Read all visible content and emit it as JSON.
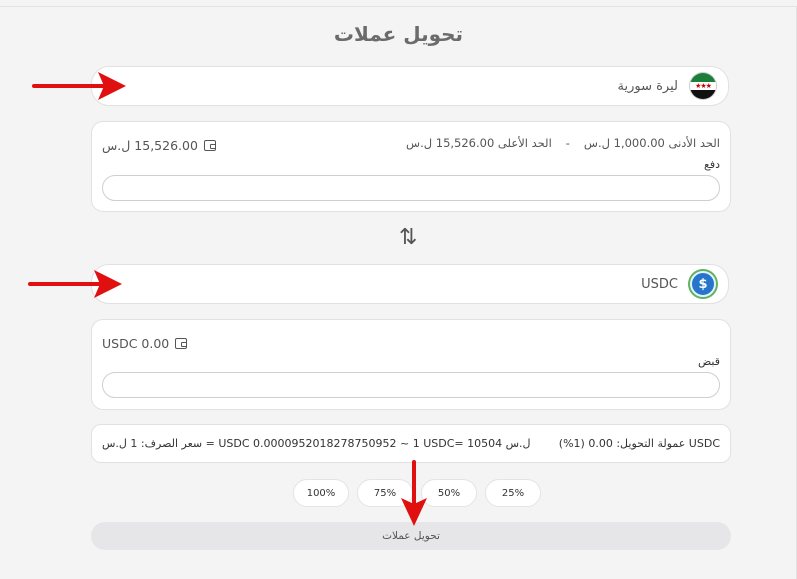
{
  "page": {
    "title": "تحويل عملات"
  },
  "from": {
    "currency_name": "ليرة سورية",
    "limits_min": "الحد الأدنى 1,000.00 ل.س",
    "limits_sep": "-",
    "limits_max": "الحد الأعلى 15,526.00 ل.س",
    "balance": "15,526.00 ل.س",
    "field_label": "دفع",
    "input_value": ""
  },
  "swap": {
    "symbol": "⇅"
  },
  "to": {
    "currency_name": "USDC",
    "balance": "USDC 0.00",
    "field_label": "قبض",
    "input_value": ""
  },
  "info": {
    "fee": "عمولة التحويل: 0.00 (1%) USDC",
    "rate": "سعر الصرف: 1 ل.س = USDC 0.0000952018278750952 ~ 1 USDC= 10504 ل.س"
  },
  "percent_buttons": [
    "100%",
    "75%",
    "50%",
    "25%"
  ],
  "submit": {
    "label": "تحويل عملات"
  },
  "colors": {
    "annotation_arrow": "#e01010",
    "usdc_blue": "#2775ca"
  }
}
